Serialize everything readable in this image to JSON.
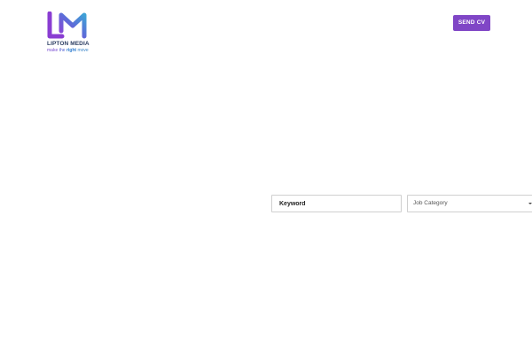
{
  "brand": {
    "name": "LIPTON MEDIA",
    "tagline": [
      "make",
      "the",
      "right",
      "move"
    ],
    "logo_colors": [
      "#8f3fd6",
      "#4a8fd9"
    ]
  },
  "header": {
    "cta_label": "SEND CV",
    "cta_color": "#8046c6"
  },
  "search": {
    "keyword_placeholder": "Keyword",
    "category_selected": "Job Category"
  }
}
